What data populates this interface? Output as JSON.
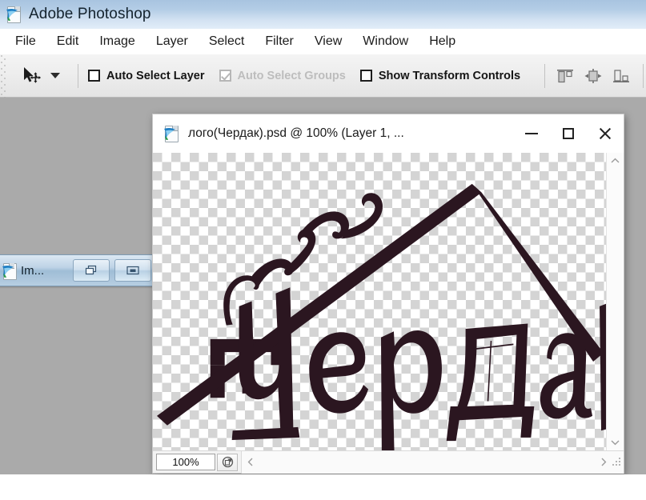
{
  "app": {
    "title": "Adobe Photoshop",
    "icon": "photoshop-icon",
    "workspace_color": "#aaaaaa"
  },
  "menubar": {
    "items": [
      {
        "label": "File"
      },
      {
        "label": "Edit"
      },
      {
        "label": "Image"
      },
      {
        "label": "Layer"
      },
      {
        "label": "Select"
      },
      {
        "label": "Filter"
      },
      {
        "label": "View"
      },
      {
        "label": "Window"
      },
      {
        "label": "Help"
      }
    ]
  },
  "options_bar": {
    "tool": {
      "name": "move-tool",
      "icon": "move-tool-icon",
      "dropdown_icon": "chevron-down-icon"
    },
    "checkboxes": [
      {
        "label": "Auto Select Layer",
        "checked": false,
        "disabled": false
      },
      {
        "label": "Auto Select Groups",
        "checked": true,
        "disabled": true
      },
      {
        "label": "Show Transform Controls",
        "checked": false,
        "disabled": false
      }
    ],
    "align_buttons": [
      {
        "name": "align-top-edges-icon"
      },
      {
        "name": "align-horizontal-centers-icon"
      },
      {
        "name": "align-bottom-edges-icon"
      }
    ]
  },
  "background_window": {
    "title": "Im...",
    "icon": "photoshop-icon",
    "buttons": [
      {
        "name": "restore-button",
        "icon": "restore-icon"
      },
      {
        "name": "maximize-button",
        "icon": "maximize-icon"
      }
    ]
  },
  "document_window": {
    "title": "лого(Чердак).psd @ 100% (Layer 1, ...",
    "icon": "psd-document-icon",
    "controls": {
      "minimize": "minimize-button",
      "maximize": "maximize-button",
      "close": "close-button"
    },
    "status": {
      "zoom": "100%",
      "doc_info_button": "document-info-icon",
      "scroll_left": "scroll-left-arrow",
      "scroll_right": "scroll-right-arrow",
      "resize_grip": "resize-grip"
    },
    "vertical_scrollbar": {
      "up_arrow": "scroll-up-arrow",
      "down_arrow": "scroll-down-arrow"
    },
    "artwork": {
      "description": "Чердак logo — house roof with chimney and smoke",
      "word": "Чердак",
      "ink_color": "#2b1620",
      "transparent_background": true
    }
  }
}
